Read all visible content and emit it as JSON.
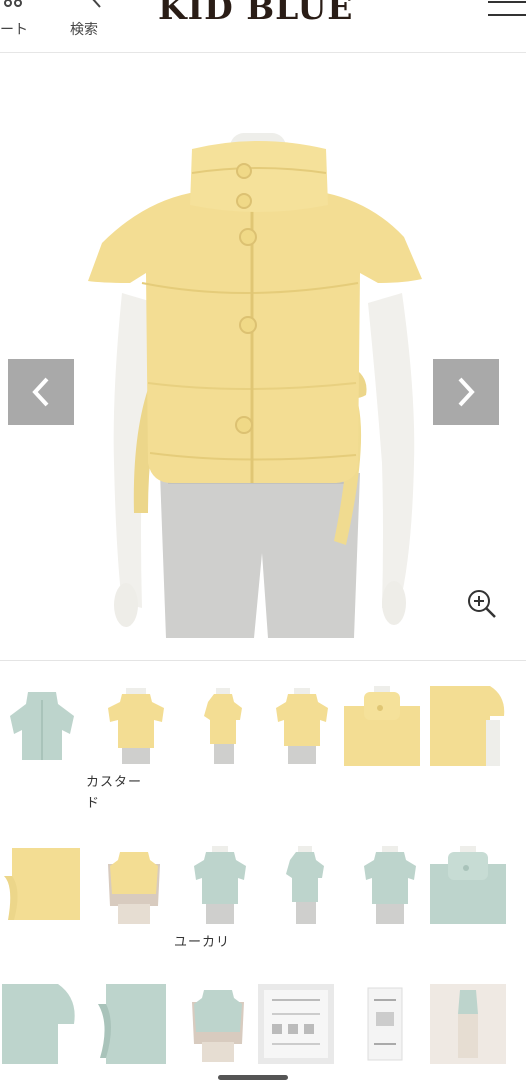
{
  "header": {
    "cart_label": "カート",
    "cart_label_visible": "ート",
    "search_label": "検索",
    "brand": "KID BLUE",
    "menu_icon": "hamburger-menu-icon"
  },
  "product_gallery": {
    "main_image_alt": "yellow quilted sleeveless vest with high collar on mannequin",
    "prev_icon": "chevron-left-icon",
    "next_icon": "chevron-right-icon",
    "zoom_icon": "zoom-in-icon",
    "colors": {
      "custard": "#f3dd93",
      "eucalyptus": "#bdd4cc",
      "arrow_bg": "#a9a9a9",
      "pants": "#cfcfcd"
    }
  },
  "thumbnails": {
    "row1": [
      "eucalyptus-vest-flat",
      "custard-vest-front",
      "custard-vest-side",
      "custard-vest-back",
      "custard-collar-detail",
      "custard-shoulder-detail"
    ],
    "row2": [
      "custard-side-detail",
      "custard-vest-layered",
      "eucalyptus-vest-front",
      "eucalyptus-vest-side",
      "eucalyptus-vest-back",
      "eucalyptus-collar-detail"
    ],
    "row3": [
      "eucalyptus-shoulder-detail",
      "eucalyptus-side-detail",
      "eucalyptus-vest-layered",
      "care-label",
      "size-tag",
      "model-outfit"
    ]
  },
  "color_captions": {
    "custard": "カスタード",
    "custard_line1": "カスター",
    "custard_line2": "ド",
    "eucalyptus": "ユーカリ"
  }
}
